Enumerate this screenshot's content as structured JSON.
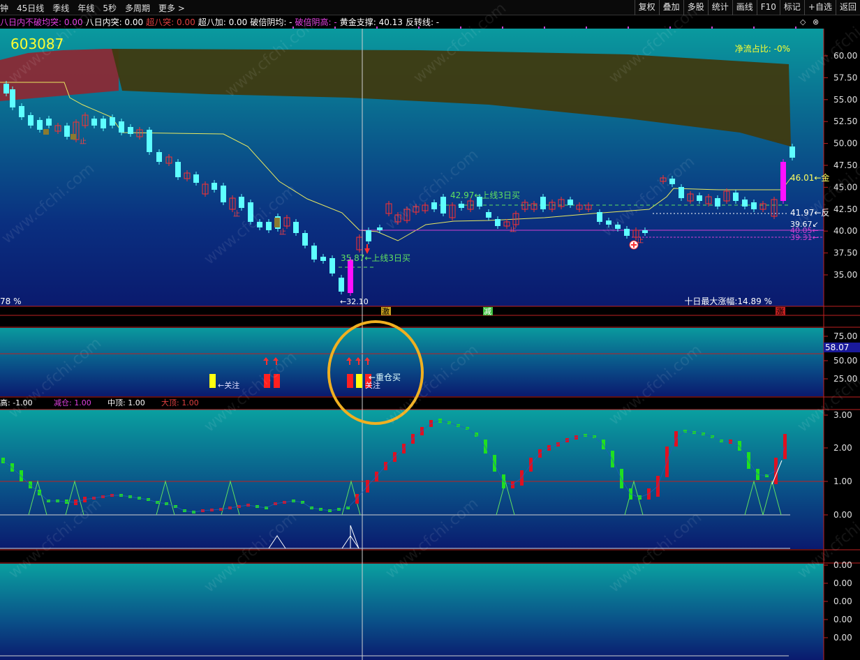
{
  "toolbar": {
    "left": [
      "钟",
      "45日线",
      "季线",
      "年线",
      "5秒",
      "多周期",
      "更多 >"
    ],
    "right": [
      "复权",
      "叠加",
      "多股",
      "统计",
      "画线",
      "F10",
      "标记",
      "+自选",
      "返回"
    ]
  },
  "infobar": [
    {
      "label": "八日内不破均突:",
      "value": "0.00",
      "color": "#e040e0"
    },
    {
      "label": "八日内突:",
      "value": "0.00",
      "color": "#ffffff"
    },
    {
      "label": "超八突:",
      "value": "0.00",
      "color": "#e04040"
    },
    {
      "label": "超八加:",
      "value": "0.00",
      "color": "#ffffff"
    },
    {
      "label": "破倍阴均:",
      "value": "-",
      "color": "#ffffff"
    },
    {
      "label": "破倍阴高:",
      "value": "-",
      "color": "#e040e0"
    },
    {
      "label": "黄金支撑:",
      "value": "40.13",
      "color": "#ffffff"
    },
    {
      "label": "反转线:",
      "value": "-",
      "color": "#ffffff"
    }
  ],
  "main_chart": {
    "stock_code": "603087",
    "net_flow": "净流占比: -0%",
    "price_axis": [
      "60.00",
      "57.50",
      "55.00",
      "52.50",
      "50.00",
      "47.50",
      "45.00",
      "42.50",
      "40.00",
      "37.50",
      "35.00"
    ],
    "bottom_left": "78 %",
    "bottom_right": "十日最大涨幅:14.89 %",
    "low_label": "←32.10",
    "buy_signal_1": "35.87←上线3日买",
    "buy_signal_2": "42.97←上线3日买",
    "right_labels": [
      "46.01←金",
      "41.97←反",
      "39.67↙",
      "40.05←",
      "39.31←"
    ],
    "markers": [
      "激",
      "减",
      "涨"
    ],
    "stop_label_1": "止",
    "stop_label_2": "止",
    "stop_label_3": "止",
    "stop_label_4": "止",
    "stop_label_5": "止"
  },
  "panel2": {
    "axis": [
      "75.00",
      "50.00",
      "25.00"
    ],
    "highlight_value": "58.07",
    "labels": [
      "关注",
      "关注",
      "←重仓买"
    ]
  },
  "panel3": {
    "infobar": [
      {
        "label": "高:",
        "value": "-1.00",
        "color": "#ffffff"
      },
      {
        "label": "减仓:",
        "value": "1.00",
        "color": "#e040e0"
      },
      {
        "label": "中顶:",
        "value": "1.00",
        "color": "#ffffff"
      },
      {
        "label": "大顶:",
        "value": "1.00",
        "color": "#e04040"
      }
    ],
    "axis": [
      "3.00",
      "2.00",
      "1.00",
      "0.00"
    ]
  },
  "panel4": {
    "axis": [
      "0.00",
      "0.00",
      "0.00",
      "0.00",
      "0.00"
    ]
  },
  "watermark": "www.cfchi.com",
  "colors": {
    "up": "#ff3030",
    "down": "#54ffff",
    "magenta": "#ff00ff",
    "yellow": "#ffff00",
    "green": "#00e000"
  }
}
